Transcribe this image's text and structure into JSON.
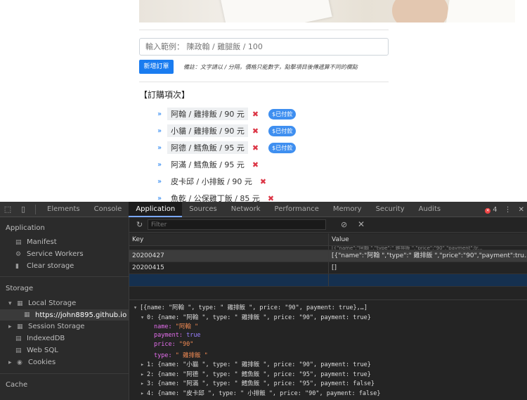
{
  "web": {
    "input_placeholder": "輸入範例： 陳政翰 / 雞腿飯 / 100",
    "add_button": "新增訂單",
    "note": "備註：文字請以 / 分隔，價格只能數字，點擊項目後傳遞算不同的欄點",
    "list_title": "【訂購項次】",
    "orders": [
      {
        "text": "阿翰 / 雞排飯 / 90 元",
        "paid": true,
        "badge": "$已付款"
      },
      {
        "text": "小貓 / 雞排飯 / 90 元",
        "paid": true,
        "badge": "$已付款"
      },
      {
        "text": "阿德 / 鱈魚飯 / 95 元",
        "paid": true,
        "badge": "$已付款"
      },
      {
        "text": "阿滿 / 鱈魚飯 / 95 元",
        "paid": false,
        "badge": ""
      },
      {
        "text": "皮卡邱 / 小排飯 / 90 元",
        "paid": false,
        "badge": ""
      },
      {
        "text": "魚乾 / 公保雞丁飯 / 85 元",
        "paid": false,
        "badge": ""
      }
    ],
    "chevron": "»",
    "delete_mark": "✖"
  },
  "devtools": {
    "tabs": [
      "Elements",
      "Console",
      "Application",
      "Sources",
      "Network",
      "Performance",
      "Memory",
      "Security",
      "Audits"
    ],
    "active_tab": "Application",
    "error_count": "4",
    "sidebar": {
      "application_title": "Application",
      "application_items": [
        "Manifest",
        "Service Workers",
        "Clear storage"
      ],
      "storage_title": "Storage",
      "storage_items": [
        "Local Storage",
        "https://john8895.github.io",
        "Session Storage",
        "IndexedDB",
        "Web SQL",
        "Cookies"
      ],
      "cache_title": "Cache"
    },
    "filter_placeholder": "Filter",
    "table": {
      "key_header": "Key",
      "value_header": "Value",
      "partial_row": "[{\"name\":\"阿翰 \",\"type\":\" 雞排飯 \",\"price\":\"90\",\"payment\":tr...",
      "rows": [
        {
          "key": "20200427",
          "value": "[{\"name\":\"阿翰 \",\"type\":\" 雞排飯 \",\"price\":\"90\",\"payment\":tru..."
        },
        {
          "key": "20200415",
          "value": "[]"
        }
      ]
    },
    "preview": {
      "line0": "[{name: \"阿翰 \", type: \" 雞排飯 \", price: \"90\", payment: true},…]",
      "line1": "0: {name: \"阿翰 \", type: \" 雞排飯 \", price: \"90\", payment: true}",
      "name_key": "name:",
      "name_val": "\"阿翰 \"",
      "payment_key": "payment:",
      "payment_val": "true",
      "price_key": "price:",
      "price_val": "\"90\"",
      "type_key": "type:",
      "type_val": "\" 雞排飯 \"",
      "line2": "1: {name: \"小貓 \", type: \" 雞排飯 \", price: \"90\", payment: true}",
      "line3": "2: {name: \"阿德 \", type: \" 鱈魚飯 \", price: \"95\", payment: true}",
      "line4": "3: {name: \"阿滿 \", type: \" 鱈魚飯 \", price: \"95\", payment: false}",
      "line5": "4: {name: \"皮卡邱 \", type: \" 小排飯 \", price: \"90\", payment: false}"
    }
  }
}
